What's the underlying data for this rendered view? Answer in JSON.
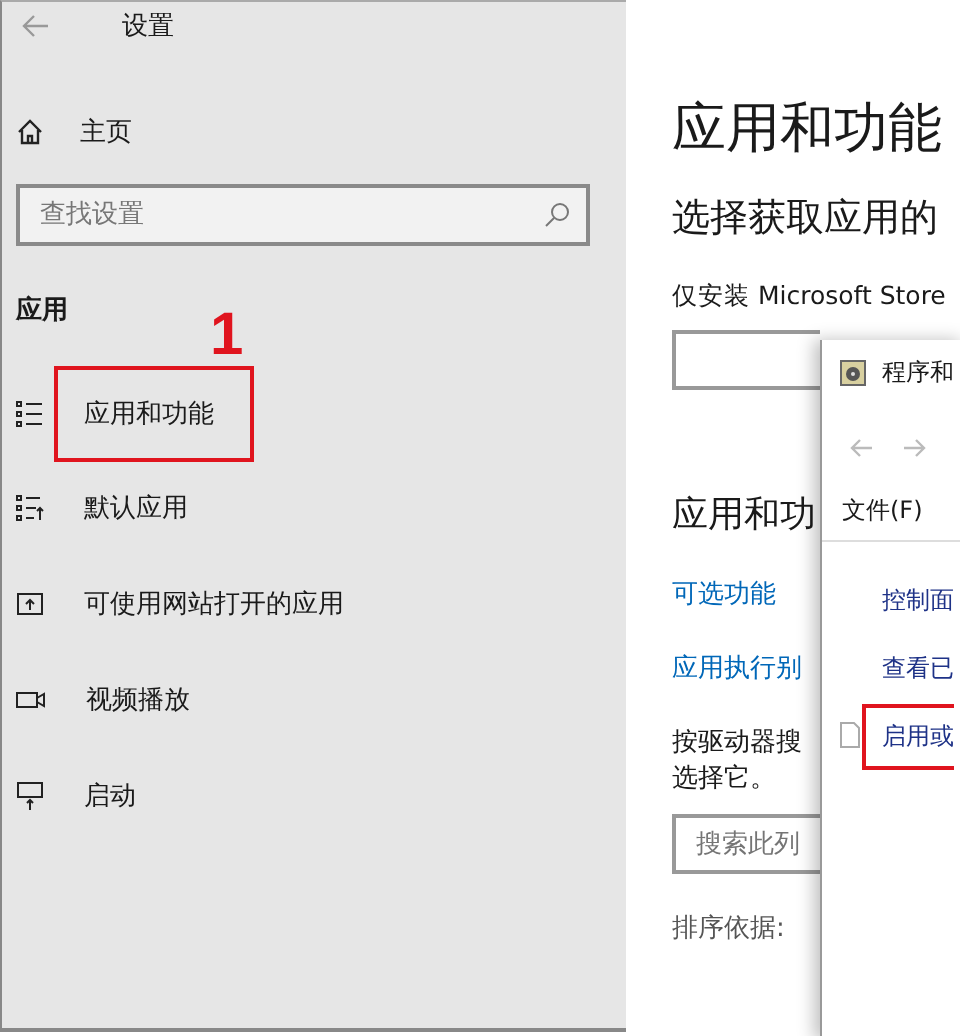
{
  "sidebar": {
    "title": "设置",
    "home": "主页",
    "search": {
      "placeholder": "查找设置"
    },
    "section": "应用",
    "items": [
      {
        "kind": "list",
        "label": "应用和功能",
        "highlighted": true
      },
      {
        "kind": "defaults",
        "label": "默认应用",
        "highlighted": false
      },
      {
        "kind": "web",
        "label": "可使用网站打开的应用",
        "highlighted": false
      },
      {
        "kind": "video",
        "label": "视频播放",
        "highlighted": false
      },
      {
        "kind": "startup",
        "label": "启动",
        "highlighted": false
      }
    ]
  },
  "main": {
    "title": "应用和功能",
    "subtitle": "选择获取应用的",
    "install_label": "仅安装 Microsoft Store",
    "section": "应用和功",
    "links": [
      "可选功能",
      "应用执行别"
    ],
    "description": [
      "按驱动器搜",
      "选择它。"
    ],
    "search": {
      "placeholder": "搜索此列"
    },
    "sort_label": "排序依据:"
  },
  "dialog": {
    "title": "程序和",
    "menu": [
      "文件(F)"
    ],
    "items": [
      {
        "label": "控制面",
        "highlighted": false
      },
      {
        "label": "查看已",
        "highlighted": false
      },
      {
        "label": "启用或",
        "highlighted": true
      }
    ]
  },
  "annotation": "1"
}
